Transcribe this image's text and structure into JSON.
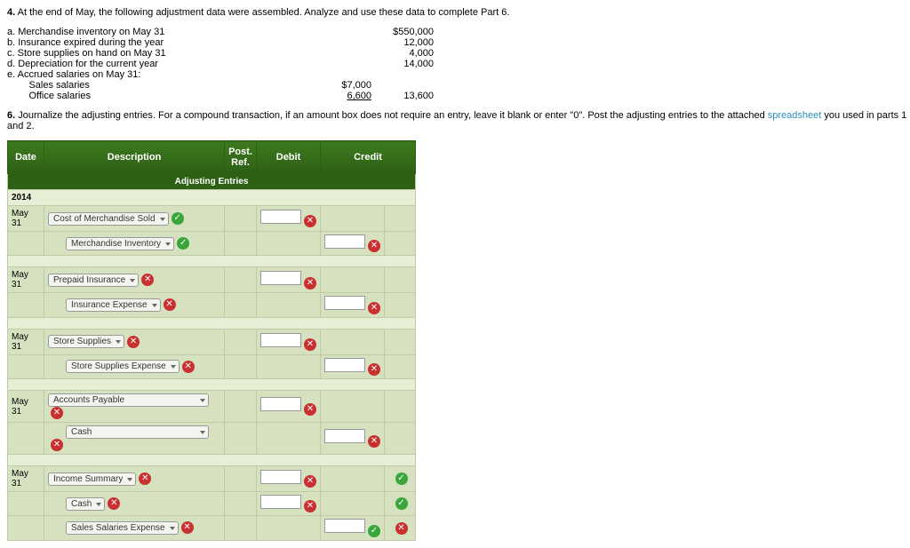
{
  "intro": {
    "num": "4.",
    "text": "At the end of May, the following adjustment data were assembled. Analyze and use these data to complete Part 6."
  },
  "adjustments": {
    "a": {
      "label": "a.  Merchandise inventory on May 31",
      "c2": "$550,000"
    },
    "b": {
      "label": "b.  Insurance expired during the year",
      "c2": "12,000"
    },
    "c": {
      "label": "c.  Store supplies on hand on May 31",
      "c2": "4,000"
    },
    "d": {
      "label": "d.  Depreciation for the current year",
      "c2": "14,000"
    },
    "e": {
      "label": "e.  Accrued salaries on May 31:"
    },
    "e1": {
      "label": "        Sales salaries",
      "c1": "$7,000"
    },
    "e2": {
      "label": "        Office salaries",
      "c1": "6,600",
      "c2": "13,600"
    }
  },
  "instruction": {
    "num": "6.",
    "text1": "Journalize the adjusting entries. For a compound transaction, if an amount box does not require an entry, leave it blank or enter \"0\". Post the adjusting entries to the attached ",
    "link": "spreadsheet",
    "text2": " you used in parts 1 and 2."
  },
  "headers": {
    "date": "Date",
    "desc": "Description",
    "post": "Post.\nRef.",
    "debit": "Debit",
    "credit": "Credit"
  },
  "subheader": "Adjusting Entries",
  "year": "2014",
  "dates": {
    "d1": "May 31",
    "d2": "May 31",
    "d3": "May 31",
    "d4": "May 31",
    "d5": "May 31"
  },
  "rows": {
    "r1a": "Cost of Merchandise Sold",
    "r1b": "Merchandise Inventory",
    "r2a": "Prepaid Insurance",
    "r2b": "Insurance Expense",
    "r3a": "Store Supplies",
    "r3b": "Store Supplies Expense",
    "r4a": "Accounts Payable",
    "r4b": "Cash",
    "r5a": "Income Summary",
    "r5b": "Cash",
    "r5c": "Sales Salaries Expense"
  }
}
